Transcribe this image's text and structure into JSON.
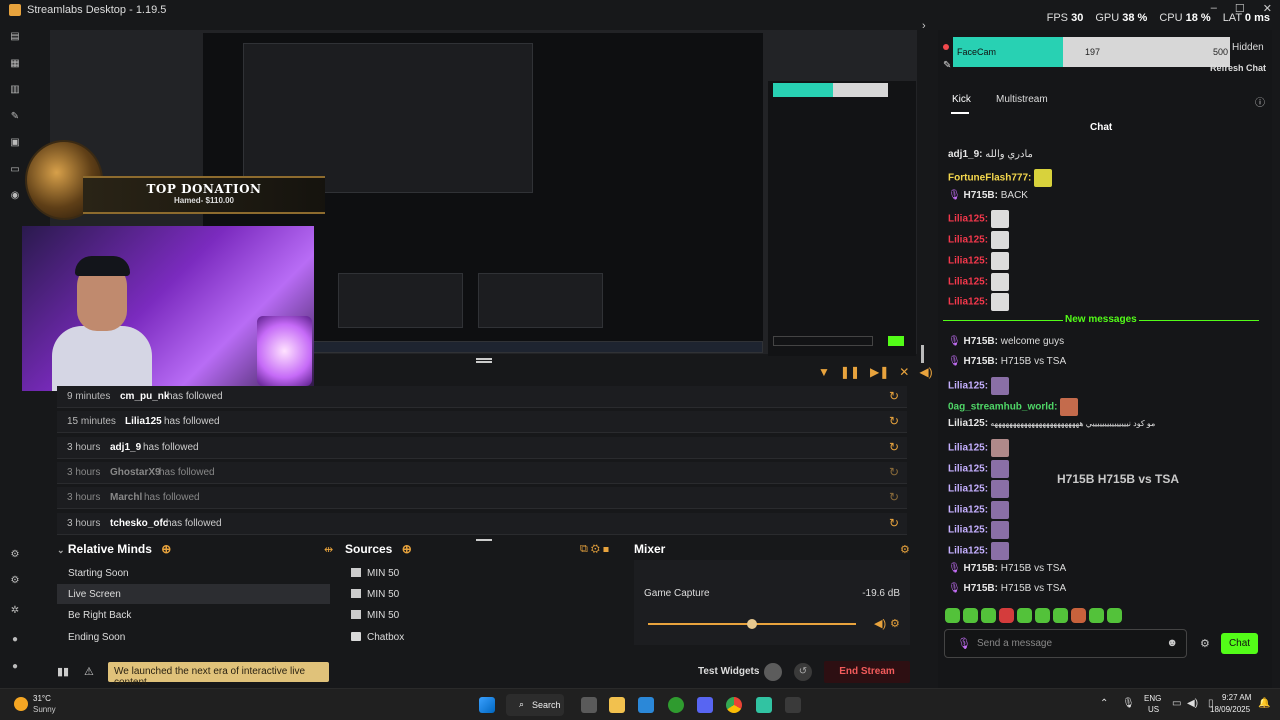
{
  "app": {
    "title": "Streamlabs Desktop - 1.19.5",
    "win_buttons": [
      "–",
      "☐",
      "✕"
    ]
  },
  "stats": {
    "fps_label": "FPS",
    "fps": "30",
    "gpu_label": "GPU",
    "gpu": "38 %",
    "cpu_label": "CPU",
    "cpu": "18 %",
    "lat_label": "LAT",
    "lat": "0 ms"
  },
  "overlay": {
    "donation_title": "TOP DONATION",
    "donation_sub": "Hamed- $110.00"
  },
  "events": [
    {
      "time": "9 minutes",
      "name": "cm_pu_nk",
      "action": "has followed",
      "dim": false
    },
    {
      "time": "15 minutes",
      "name": "Lilia125",
      "action": "has followed",
      "dim": false
    },
    {
      "time": "3 hours",
      "name": "adj1_9",
      "action": "has followed",
      "dim": false
    },
    {
      "time": "3 hours",
      "name": "GhostarX9",
      "action": "has followed",
      "dim": true
    },
    {
      "time": "3 hours",
      "name": "Marchl",
      "action": "has followed",
      "dim": true
    },
    {
      "time": "3 hours",
      "name": "tchesko_ofc",
      "action": "has followed",
      "dim": false
    }
  ],
  "scenes": {
    "title": "Relative Minds",
    "items": [
      "Starting Soon",
      "Live Screen",
      "Be Right Back",
      "Ending Soon"
    ],
    "active": "Live Screen"
  },
  "sources": {
    "title": "Sources",
    "items": [
      "MIN 50",
      "MIN 50",
      "MIN 50",
      "Chatbox"
    ]
  },
  "mixer": {
    "title": "Mixer",
    "channel": "Game Capture",
    "level": "-19.6 dB",
    "fader_fraction": 0.5
  },
  "bottom": {
    "news": "We launched the next era of interactive live content",
    "test_widgets": "Test Widgets",
    "end_stream": "End Stream"
  },
  "chat": {
    "facecam_label": "FaceCam",
    "value_mid": "197",
    "value_max": "500",
    "hidden": "Hidden",
    "refresh": "Refresh Chat",
    "tabs": [
      "Kick",
      "Multistream"
    ],
    "title": "Chat",
    "messages_before": [
      {
        "user": "adj1_9:",
        "text": "مادري والله",
        "color": "u-white"
      },
      {
        "user": "FortuneFlash777:",
        "text": "",
        "color": "u-gold"
      },
      {
        "user": "H715B:",
        "text": "BACK",
        "color": "u-white"
      },
      {
        "user": "Lilia125:",
        "text": "",
        "color": "u-red"
      },
      {
        "user": "Lilia125:",
        "text": "",
        "color": "u-red"
      },
      {
        "user": "Lilia125:",
        "text": "",
        "color": "u-red"
      },
      {
        "user": "Lilia125:",
        "text": "",
        "color": "u-red"
      },
      {
        "user": "Lilia125:",
        "text": "",
        "color": "u-red"
      }
    ],
    "new_messages": "New messages",
    "messages_after": [
      {
        "user": "H715B:",
        "text": "welcome guys",
        "color": "u-white"
      },
      {
        "user": "H715B:",
        "text": "H715B vs TSA",
        "color": "u-white"
      },
      {
        "user": "Lilia125:",
        "text": "",
        "color": "u-purple"
      },
      {
        "user": "0ag_streamhub_world:",
        "text": "",
        "color": "u-green"
      },
      {
        "user": "Lilia125:",
        "text": "مو كود نيييييييييييييييي ههههههههههههههههههههههههه",
        "color": "u-white"
      },
      {
        "user": "Lilia125:",
        "text": "",
        "color": "u-purple"
      },
      {
        "user": "Lilia125:",
        "text": "",
        "color": "u-purple"
      },
      {
        "user": "Lilia125:",
        "text": "",
        "color": "u-purple"
      },
      {
        "user": "Lilia125:",
        "text": "",
        "color": "u-purple"
      },
      {
        "user": "Lilia125:",
        "text": "",
        "color": "u-purple"
      },
      {
        "user": "Lilia125:",
        "text": "",
        "color": "u-purple"
      },
      {
        "user": "H715B:",
        "text": "H715B vs TSA",
        "color": "u-white"
      },
      {
        "user": "H715B:",
        "text": "H715B vs TSA",
        "color": "u-white"
      }
    ],
    "overlay_text": "H715B  H715B vs TSA",
    "input_placeholder": "Send a message",
    "send": "Chat"
  },
  "taskbar": {
    "temp": "31°C",
    "weather": "Sunny",
    "search": "Search",
    "lang": "ENG",
    "region": "US",
    "time": "9:27 AM",
    "date": "18/09/2025"
  },
  "colors": {
    "accent": "#e8a33d",
    "kick_green": "#53fc18",
    "teal": "#28d1b3",
    "danger": "#f15b5b"
  }
}
